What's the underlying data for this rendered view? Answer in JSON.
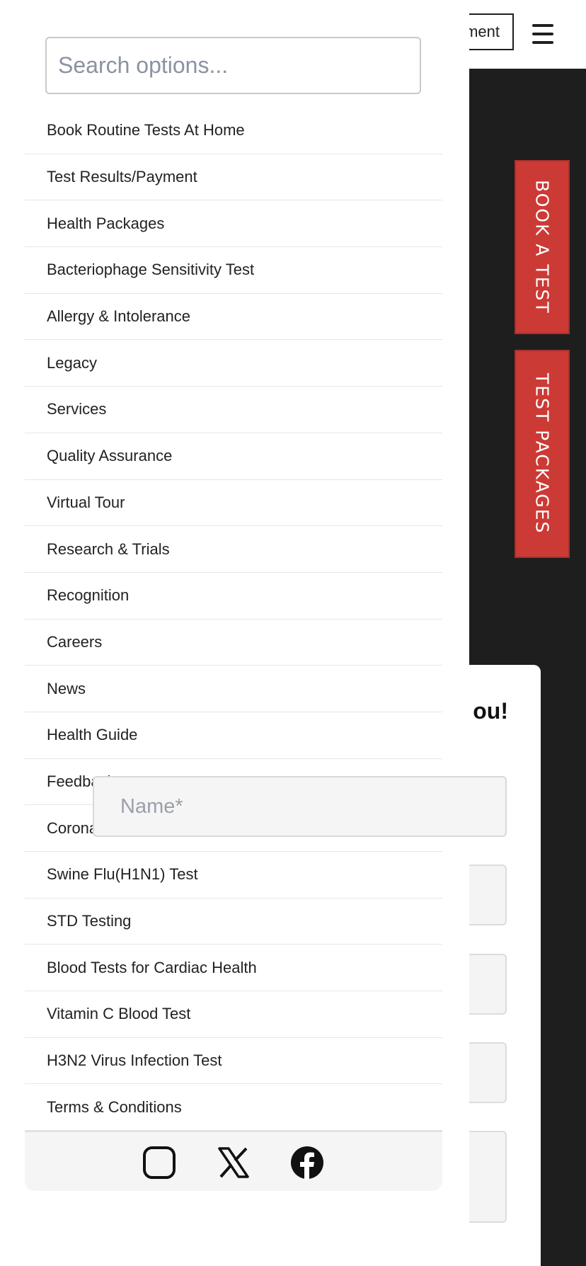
{
  "header": {
    "appointment_button_label": "ment"
  },
  "side_tabs": {
    "book_a_test": "BOOK A TEST",
    "test_packages": "TEST PACKAGES"
  },
  "form": {
    "heading_fragment": "ou!",
    "name_placeholder": "Name*"
  },
  "drawer": {
    "search_placeholder": "Search options...",
    "menu_items": [
      {
        "label": "Book Routine Tests At Home"
      },
      {
        "label": "Test Results/Payment"
      },
      {
        "label": "Health Packages"
      },
      {
        "label": "Bacteriophage Sensitivity Test"
      },
      {
        "label": "Allergy & Intolerance"
      },
      {
        "label": "Legacy"
      },
      {
        "label": "Services"
      },
      {
        "label": "Quality Assurance"
      },
      {
        "label": "Virtual Tour"
      },
      {
        "label": "Research & Trials"
      },
      {
        "label": "Recognition"
      },
      {
        "label": "Careers"
      },
      {
        "label": "News"
      },
      {
        "label": "Health Guide"
      },
      {
        "label": "Feedback"
      },
      {
        "label": "Corona"
      },
      {
        "label": "Swine Flu(H1N1) Test"
      },
      {
        "label": "STD Testing"
      },
      {
        "label": "Blood Tests for Cardiac Health"
      },
      {
        "label": "Vitamin C Blood Test"
      },
      {
        "label": "H3N2 Virus Infection Test"
      },
      {
        "label": "Terms & Conditions"
      }
    ],
    "social_icons": [
      "instagram-icon",
      "x-twitter-icon",
      "facebook-icon"
    ]
  },
  "colors": {
    "accent_red": "#cc3a35",
    "dark_background": "#1e1e1e"
  }
}
